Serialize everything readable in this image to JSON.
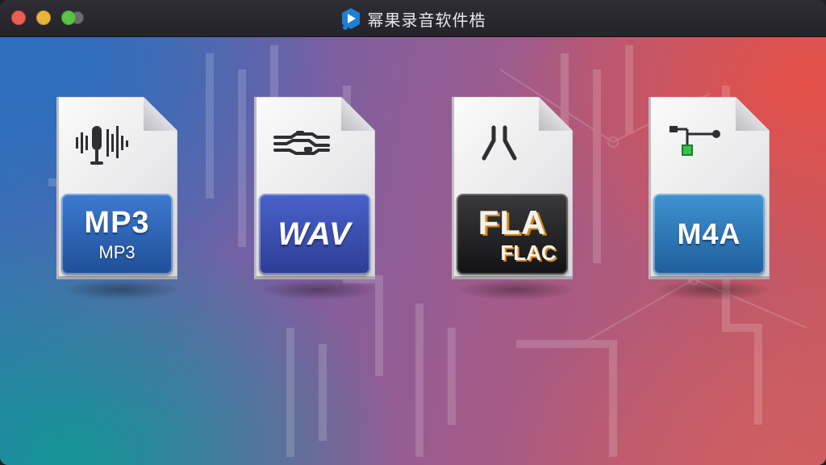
{
  "window": {
    "title": "幂果录音软件梏"
  },
  "titlebar": {
    "controls": [
      "close",
      "minimize",
      "zoom"
    ],
    "logo_icon": "app-logo-icon"
  },
  "formats": [
    {
      "id": "mp3",
      "main": "MP3",
      "sub": "MP3",
      "icon": "microphone-waveform-icon",
      "color": "#2d63b5"
    },
    {
      "id": "wav",
      "main": "WAV",
      "sub": "",
      "icon": "audio-waveform-icon",
      "color": "#3a4fb0"
    },
    {
      "id": "flac",
      "main": "FLA",
      "sub": "FLAC",
      "icon": "split-path-icon",
      "color": "#1f1f21"
    },
    {
      "id": "m4a",
      "main": "M4A",
      "sub": "",
      "icon": "node-graph-icon",
      "color": "#2c78b8"
    }
  ]
}
